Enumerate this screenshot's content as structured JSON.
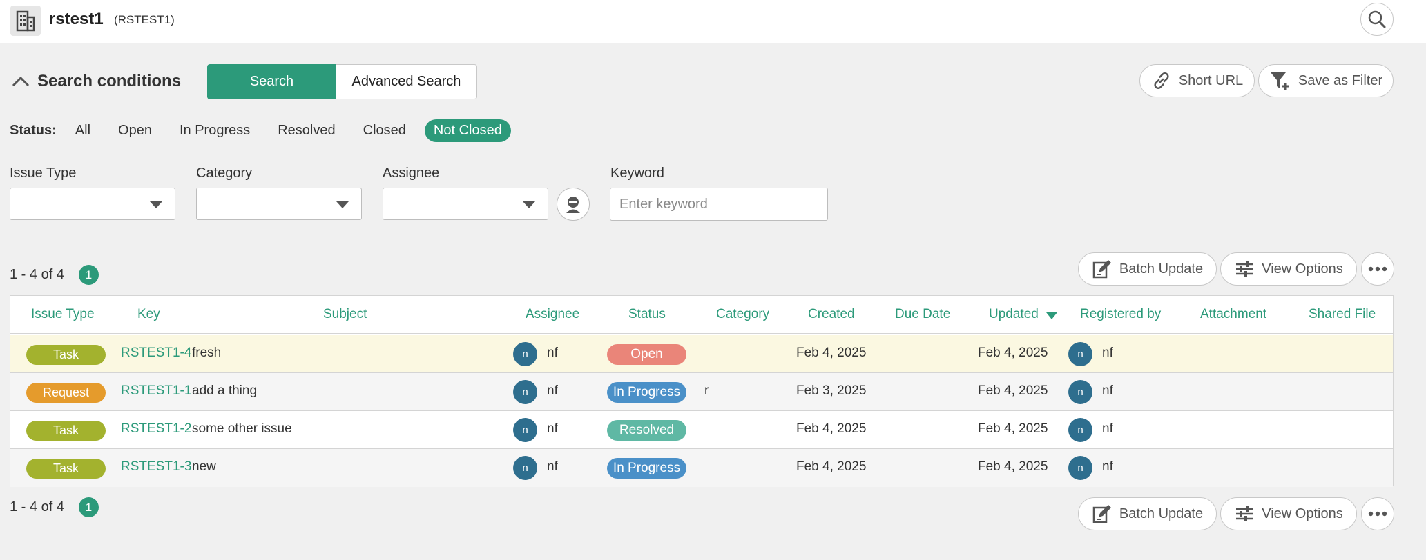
{
  "header": {
    "project_name": "rstest1",
    "project_key": "(RSTEST1)"
  },
  "conditions": {
    "title": "Search conditions",
    "search_tab": "Search",
    "advanced_tab": "Advanced Search",
    "short_url": "Short URL",
    "save_filter": "Save as Filter"
  },
  "status_filter": {
    "label": "Status:",
    "options": [
      "All",
      "Open",
      "In Progress",
      "Resolved",
      "Closed",
      "Not Closed"
    ],
    "selected": "Not Closed"
  },
  "filters": {
    "issue_type_label": "Issue Type",
    "category_label": "Category",
    "assignee_label": "Assignee",
    "keyword_label": "Keyword",
    "keyword_placeholder": "Enter keyword",
    "keyword_value": ""
  },
  "results": {
    "count": "1 - 4 of 4",
    "page": "1",
    "batch_update": "Batch Update",
    "view_options": "View Options"
  },
  "table": {
    "columns": [
      "Issue Type",
      "Key",
      "Subject",
      "Assignee",
      "Status",
      "Category",
      "Created",
      "Due Date",
      "Updated",
      "Registered by",
      "Attachment",
      "Shared File"
    ],
    "sort_column": "Updated",
    "rows": [
      {
        "type": "Task",
        "key": "RSTEST1-4",
        "subject": "fresh",
        "assignee_initial": "n",
        "assignee": "nf",
        "status": "Open",
        "category": "",
        "created": "Feb 4, 2025",
        "due": "",
        "updated": "Feb 4, 2025",
        "reg_initial": "n",
        "registered_by": "nf"
      },
      {
        "type": "Request",
        "key": "RSTEST1-1",
        "subject": "add a thing",
        "assignee_initial": "n",
        "assignee": "nf",
        "status": "In Progress",
        "category": "r",
        "created": "Feb 3, 2025",
        "due": "",
        "updated": "Feb 4, 2025",
        "reg_initial": "n",
        "registered_by": "nf"
      },
      {
        "type": "Task",
        "key": "RSTEST1-2",
        "subject": "some other issue",
        "assignee_initial": "n",
        "assignee": "nf",
        "status": "Resolved",
        "category": "",
        "created": "Feb 4, 2025",
        "due": "",
        "updated": "Feb 4, 2025",
        "reg_initial": "n",
        "registered_by": "nf"
      },
      {
        "type": "Task",
        "key": "RSTEST1-3",
        "subject": "new",
        "assignee_initial": "n",
        "assignee": "nf",
        "status": "In Progress",
        "category": "",
        "created": "Feb 4, 2025",
        "due": "",
        "updated": "Feb 4, 2025",
        "reg_initial": "n",
        "registered_by": "nf"
      }
    ]
  },
  "colors": {
    "accent": "#2c9a7a",
    "task": "#a3b22e",
    "request": "#e59b2c",
    "open": "#ea8579",
    "in_progress": "#4a90c8",
    "resolved": "#5fb8a4",
    "avatar": "#2e6e8e",
    "highlight_row": "#fbf8e1"
  },
  "icons": {
    "project": "building-icon",
    "top_search": "search-icon",
    "collapse": "chevron-up-icon",
    "short_url": "link-icon",
    "save_filter": "filter-plus-icon",
    "assign_me": "person-icon",
    "batch_update": "edit-icon",
    "view_options": "sliders-icon",
    "more": "ellipsis-icon",
    "sort": "sort-desc-icon"
  }
}
